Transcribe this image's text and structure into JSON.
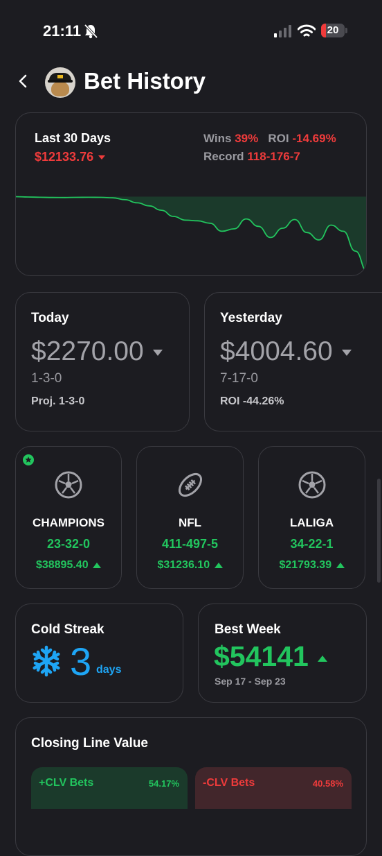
{
  "status_bar": {
    "time": "21:11",
    "battery": "20"
  },
  "header": {
    "title": "Bet History"
  },
  "summary": {
    "period_label": "Last 30 Days",
    "amount": "$12133.76",
    "wins_label": "Wins",
    "wins_value": "39%",
    "roi_label": "ROI",
    "roi_value": "-14.69%",
    "record_label": "Record",
    "record_value": "118-176-7"
  },
  "chart_data": {
    "type": "area",
    "title": "",
    "xlabel": "",
    "ylabel": "",
    "x": [
      0,
      1,
      2,
      3,
      4,
      5,
      6,
      7,
      8,
      9,
      10,
      11,
      12,
      13,
      14,
      15,
      16,
      17,
      18,
      19,
      20,
      21,
      22,
      23,
      24,
      25,
      26,
      27,
      28,
      29
    ],
    "values": [
      0,
      -60,
      -110,
      -140,
      -150,
      -120,
      -100,
      -120,
      -200,
      -500,
      -1000,
      -1500,
      -2200,
      -3200,
      -3800,
      -3900,
      -4300,
      -5600,
      -5200,
      -3600,
      -4800,
      -6600,
      -5100,
      -3700,
      -5800,
      -7000,
      -4600,
      -5600,
      -8800,
      -12133.76
    ],
    "ylim": [
      -12500,
      500
    ],
    "grid": false,
    "colors": {
      "line": "#22c55e",
      "fill": "#1b3a2b"
    }
  },
  "today": {
    "label": "Today",
    "amount": "$2270.00",
    "record": "1-3-0",
    "projection": "Proj. 1-3-0"
  },
  "yesterday": {
    "label": "Yesterday",
    "amount": "$4004.60",
    "record": "7-17-0",
    "roi": "ROI -44.26%"
  },
  "leagues": [
    {
      "name": "CHAMPIONS",
      "record": "23-32-0",
      "amount": "$38895.40",
      "icon": "soccer-ball-icon",
      "starred": true
    },
    {
      "name": "NFL",
      "record": "411-497-5",
      "amount": "$31236.10",
      "icon": "football-icon",
      "starred": false
    },
    {
      "name": "LALIGA",
      "record": "34-22-1",
      "amount": "$21793.39",
      "icon": "soccer-ball-icon",
      "starred": false
    }
  ],
  "cold_streak": {
    "label": "Cold Streak",
    "value": "3",
    "unit": "days",
    "icon": "snowflake-icon"
  },
  "best_week": {
    "label": "Best Week",
    "amount": "$54141",
    "range": "Sep 17 - Sep 23"
  },
  "clv": {
    "title": "Closing Line Value",
    "positive_label": "+CLV Bets",
    "positive_value": "54.17%",
    "negative_label": "-CLV Bets",
    "negative_value": "40.58%"
  },
  "colors": {
    "background": "#1c1c21",
    "green": "#22c55e",
    "red": "#ef3b3b",
    "blue": "#1ea5f5",
    "border": "#3a3a40"
  }
}
